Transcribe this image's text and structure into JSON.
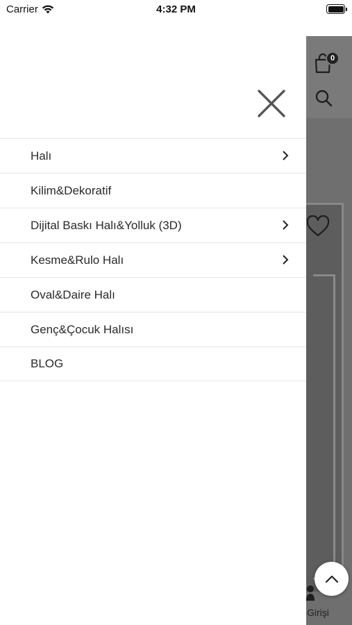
{
  "status_bar": {
    "carrier": "Carrier",
    "time": "4:32 PM"
  },
  "background_page": {
    "cart_count": "0",
    "login_label": "Girişi"
  },
  "menu": {
    "items": [
      {
        "label": "Halı",
        "has_submenu": true
      },
      {
        "label": "Kilim&Dekoratif",
        "has_submenu": false
      },
      {
        "label": "Dijital Baskı Halı&Yolluk (3D)",
        "has_submenu": true
      },
      {
        "label": "Kesme&Rulo Halı",
        "has_submenu": true
      },
      {
        "label": "Oval&Daire Halı",
        "has_submenu": false
      },
      {
        "label": "Genç&Çocuk Halısı",
        "has_submenu": false
      },
      {
        "label": "BLOG",
        "has_submenu": false
      }
    ]
  },
  "icons": {
    "close": "close-icon",
    "chevron": "chevron-right-icon",
    "cart": "shopping-bag-icon",
    "search": "search-icon",
    "favorite": "heart-icon",
    "user": "user-icon",
    "scroll_top": "chevron-up-icon"
  }
}
